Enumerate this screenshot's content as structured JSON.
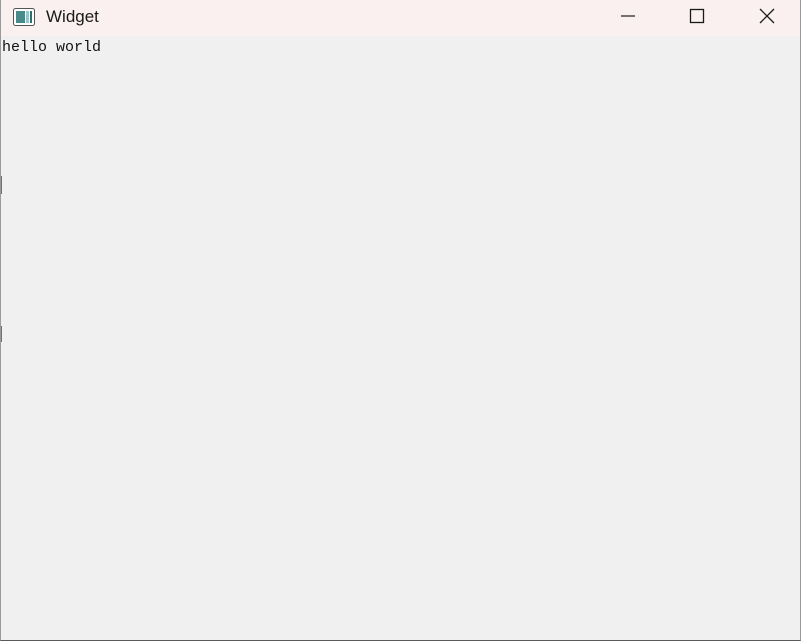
{
  "window": {
    "title": "Widget",
    "icon": "application-window-icon"
  },
  "titlebar_controls": {
    "minimize_icon": "minimize-icon",
    "maximize_icon": "maximize-icon",
    "close_icon": "close-icon"
  },
  "content": {
    "label_text": "hello world"
  },
  "colors": {
    "titlebar_bg": "#f9f0ef",
    "client_bg": "#f0f0f0",
    "text": "#111111"
  }
}
